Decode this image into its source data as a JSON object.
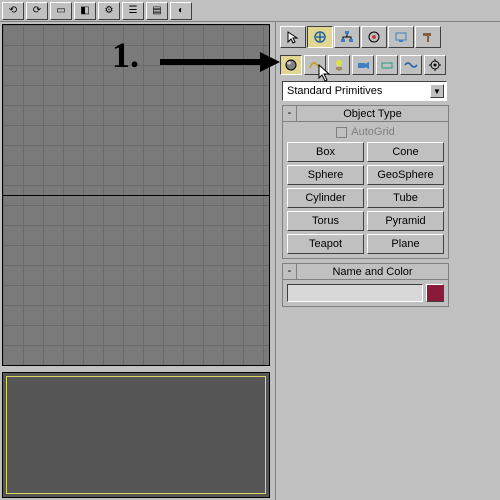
{
  "annotation": {
    "label": "1."
  },
  "dropdown": {
    "value": "Standard Primitives"
  },
  "rollouts": {
    "objectType": {
      "title": "Object Type",
      "autogrid_label": "AutoGrid",
      "minimize": "-",
      "buttons": [
        "Box",
        "Cone",
        "Sphere",
        "GeoSphere",
        "Cylinder",
        "Tube",
        "Torus",
        "Pyramid",
        "Teapot",
        "Plane"
      ]
    },
    "nameColor": {
      "title": "Name and Color",
      "minimize": "-",
      "color": "#8b1a3a"
    }
  },
  "icons": {
    "tabs": [
      "cursor",
      "create",
      "hierarchy",
      "motion",
      "display",
      "utilities"
    ],
    "subs": [
      "geometry",
      "shapes",
      "lights",
      "cameras",
      "helpers",
      "spacewarps",
      "systems"
    ]
  }
}
